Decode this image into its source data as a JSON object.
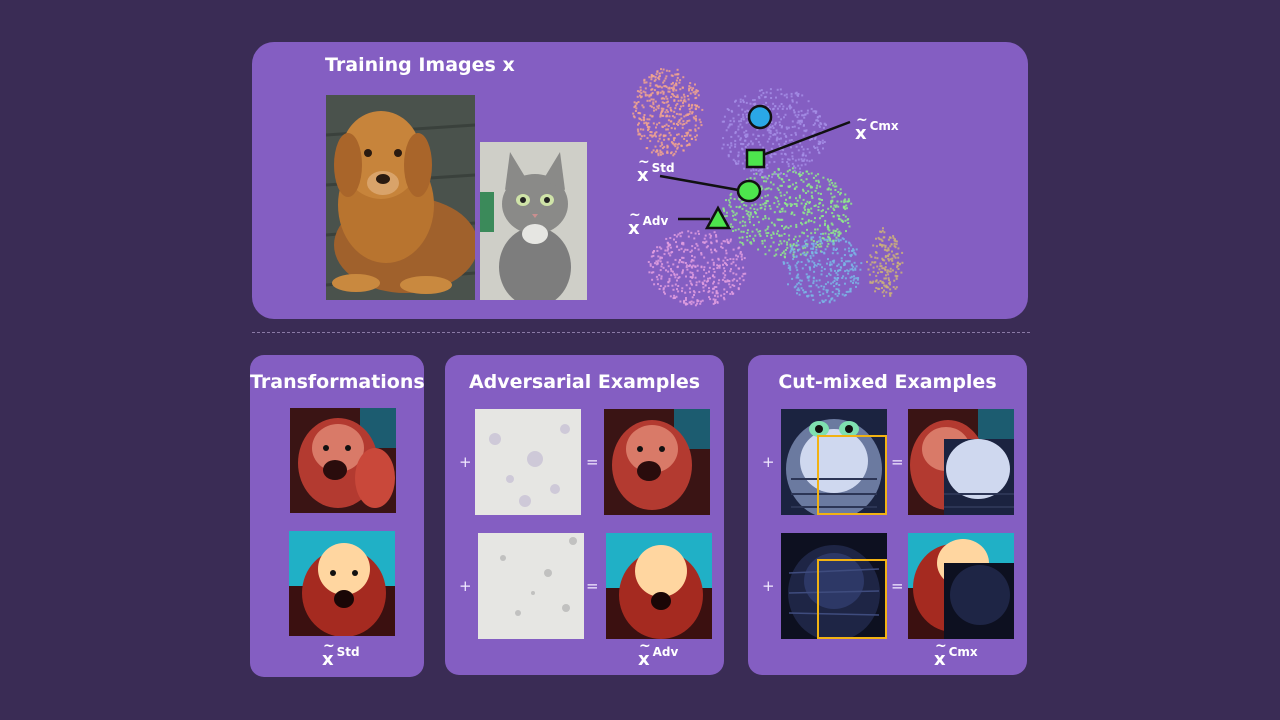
{
  "top_panel": {
    "title": "Training Images x",
    "embedding_labels": {
      "std": {
        "base": "x",
        "superscript": "Std"
      },
      "adv": {
        "base": "x",
        "superscript": "Adv"
      },
      "cmx": {
        "base": "x",
        "superscript": "Cmx"
      }
    },
    "colors": {
      "marker_green": "#4de54d",
      "marker_blue": "#2aa7e6",
      "cluster_salmon": "#f2a58e",
      "cluster_lavender": "#a48ee6",
      "cluster_green": "#8fec8a",
      "cluster_pink": "#e09ee0",
      "cluster_teal": "#7ab6e6",
      "cluster_khaki": "#cdb27a"
    }
  },
  "panels": {
    "transformations": {
      "title": "Transformations",
      "label": {
        "base": "x",
        "superscript": "Std"
      }
    },
    "adversarial": {
      "title": "Adversarial Examples",
      "plus": "+",
      "equals": "=",
      "label": {
        "base": "x",
        "superscript": "Adv"
      }
    },
    "cutmix": {
      "title": "Cut-mixed Examples",
      "plus": "+",
      "equals": "=",
      "label": {
        "base": "x",
        "superscript": "Cmx"
      },
      "box_color": "#f2b213"
    }
  }
}
